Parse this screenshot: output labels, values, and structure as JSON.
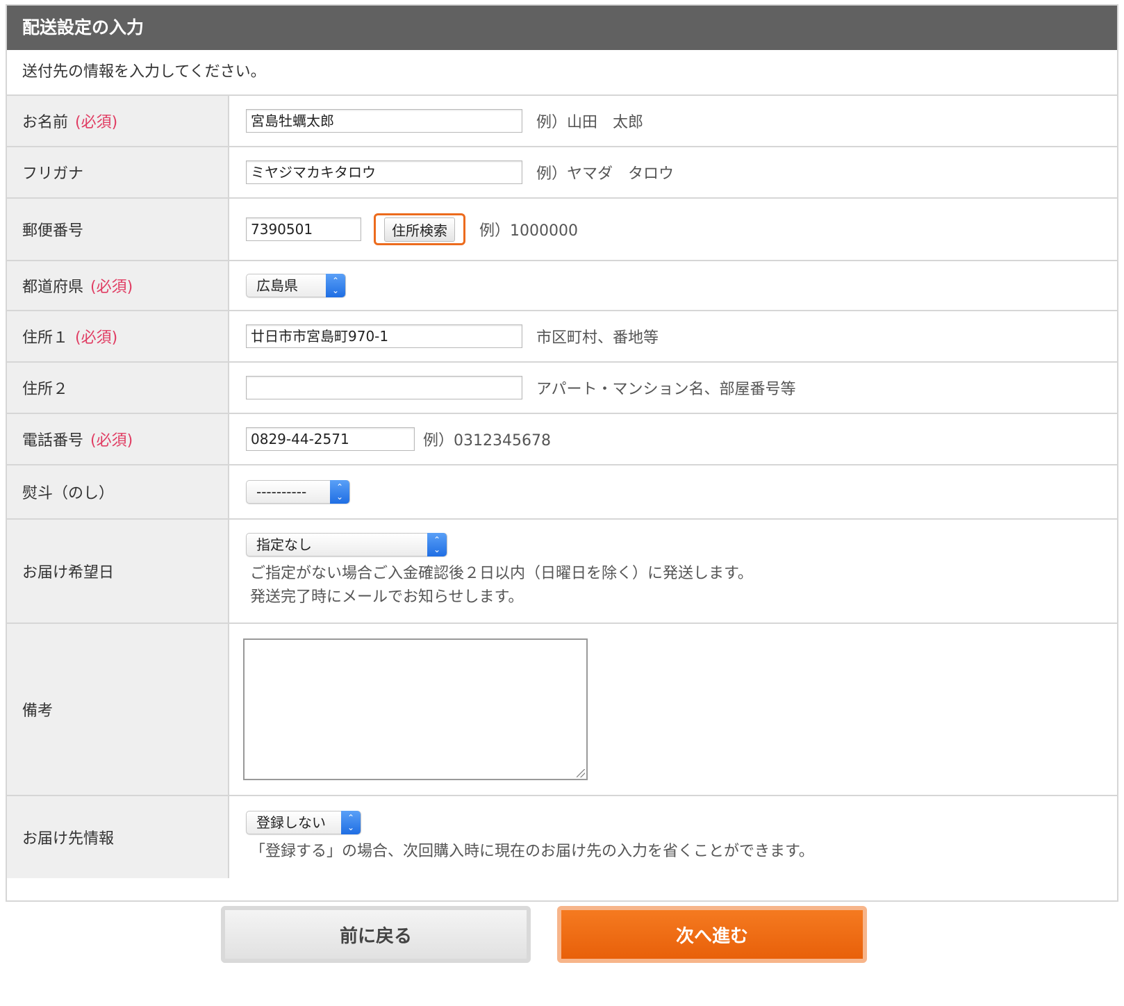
{
  "header": {
    "title": "配送設定の入力"
  },
  "intro": "送付先の情報を入力してください。",
  "required_label": "(必須)",
  "fields": {
    "name": {
      "label": "お名前",
      "value": "宮島牡蠣太郎",
      "hint": "例）山田　太郎"
    },
    "furigana": {
      "label": "フリガナ",
      "value": "ミヤジマカキタロウ",
      "hint": "例）ヤマダ　タロウ"
    },
    "postal": {
      "label": "郵便番号",
      "value": "7390501",
      "button": "住所検索",
      "hint": "例）1000000"
    },
    "prefecture": {
      "label": "都道府県",
      "selected": "広島県"
    },
    "address1": {
      "label": "住所１",
      "value": "廿日市市宮島町970-1",
      "hint": "市区町村、番地等"
    },
    "address2": {
      "label": "住所２",
      "value": "",
      "hint": "アパート・マンション名、部屋番号等"
    },
    "phone": {
      "label": "電話番号",
      "value": "0829-44-2571",
      "hint": "例）0312345678"
    },
    "noshi": {
      "label": "熨斗（のし）",
      "selected": "----------"
    },
    "delivery_date": {
      "label": "お届け希望日",
      "selected": "指定なし",
      "note_line1": "ご指定がない場合ご入金確認後２日以内（日曜日を除く）に発送します。",
      "note_line2": "発送完了時にメールでお知らせします。"
    },
    "remarks": {
      "label": "備考",
      "value": ""
    },
    "address_info": {
      "label": "お届け先情報",
      "selected": "登録しない",
      "note": "「登録する」の場合、次回購入時に現在のお届け先の入力を省くことができます。"
    }
  },
  "buttons": {
    "back": "前に戻る",
    "next": "次へ進む"
  },
  "colors": {
    "header_bg": "#616161",
    "required": "#e03c62",
    "accent": "#ec6b1d",
    "select_arrow": "#2a78e8"
  }
}
